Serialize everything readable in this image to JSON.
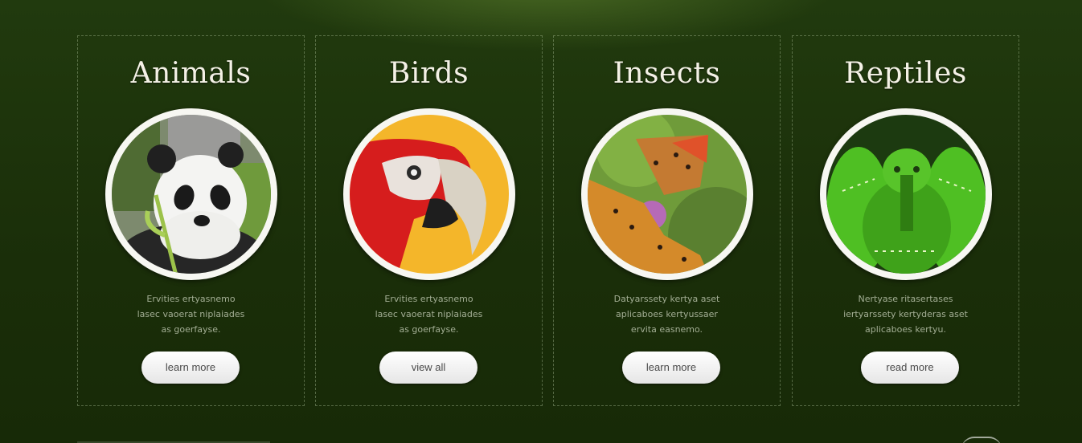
{
  "cards": [
    {
      "title": "Animals",
      "image": "panda-photo",
      "desc_lines": [
        "Ervities ertyasnemo",
        "lasec vaoerat niplaiades",
        "as goerfayse."
      ],
      "button": "learn more"
    },
    {
      "title": "Birds",
      "image": "parrot-photo",
      "desc_lines": [
        "Ervities ertyasnemo",
        "lasec vaoerat niplaiades",
        "as goerfayse."
      ],
      "button": "view all"
    },
    {
      "title": "Insects",
      "image": "butterfly-photo",
      "desc_lines": [
        "Datyarssety kertya aset",
        "aplicaboes kertyussaer",
        "ervita easnemo."
      ],
      "button": "learn more"
    },
    {
      "title": "Reptiles",
      "image": "snake-photo",
      "desc_lines": [
        "Nertyase ritasertases",
        "iertyarssety kertyderas aset",
        "aplicaboes kertyu."
      ],
      "button": "read more"
    }
  ],
  "colors": {
    "background": "#1b3009",
    "title": "#f4f1e6",
    "description": "#a3ae94",
    "button_bg": "#ffffff",
    "button_text": "#4a4a4a"
  }
}
